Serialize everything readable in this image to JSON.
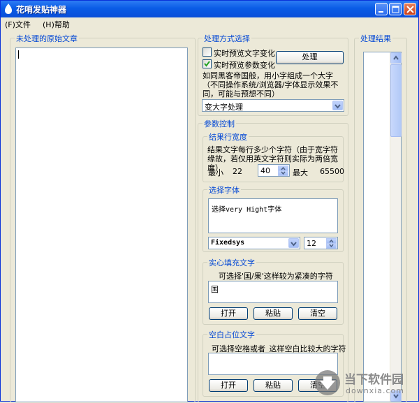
{
  "window": {
    "title": "花哨发贴神器",
    "menu": [
      "(F)文件",
      "(H)帮助"
    ]
  },
  "left_panel": {
    "title": "未处理的原始文章",
    "text": ""
  },
  "process_panel": {
    "title": "处理方式选择",
    "option_text_preview": {
      "label": "实时预览文字变化",
      "checked": false
    },
    "option_param_preview": {
      "label": "实时预览参数变化",
      "checked": true
    },
    "process_button": "处理",
    "description": "如同黑客帝国般，用小字组成一个大字（不同操作系统/浏览器/字体显示效果不同，可能与预想不同）",
    "mode_selected": "变大字处理"
  },
  "param_panel": {
    "title": "参数控制",
    "width_group": {
      "title": "结果行宽度",
      "description": "结果文字每行多少个字符（由于宽字符缘故，若仅用英文字符则实际为两倍宽度）",
      "min_label": "最小",
      "min_value": "22",
      "value": "40",
      "max_label": "最大",
      "max_value": "65500"
    },
    "font_group": {
      "title": "选择字体",
      "preview_text": "选择very Hight字体",
      "font_selected": "Fixedsys",
      "size_value": "12"
    },
    "fill_group": {
      "title": "实心填充文字",
      "hint": "可选择'国/果'这样较为紧凑的字符",
      "value": "国",
      "buttons": [
        "打开",
        "粘贴",
        "清空"
      ]
    },
    "blank_group": {
      "title": "空白占位文字",
      "hint": "可选择空格或者_这样空白比较大的字符",
      "value": "",
      "buttons": [
        "打开",
        "粘贴",
        "清空"
      ]
    }
  },
  "result_panel": {
    "title": "处理结果",
    "text": ""
  },
  "watermark": {
    "brand": "当下软件园",
    "domain": "downxia.com"
  },
  "colors": {
    "titlebar": "#0a5ce6",
    "group_title": "#0046d5",
    "window_bg": "#ece9d8"
  }
}
